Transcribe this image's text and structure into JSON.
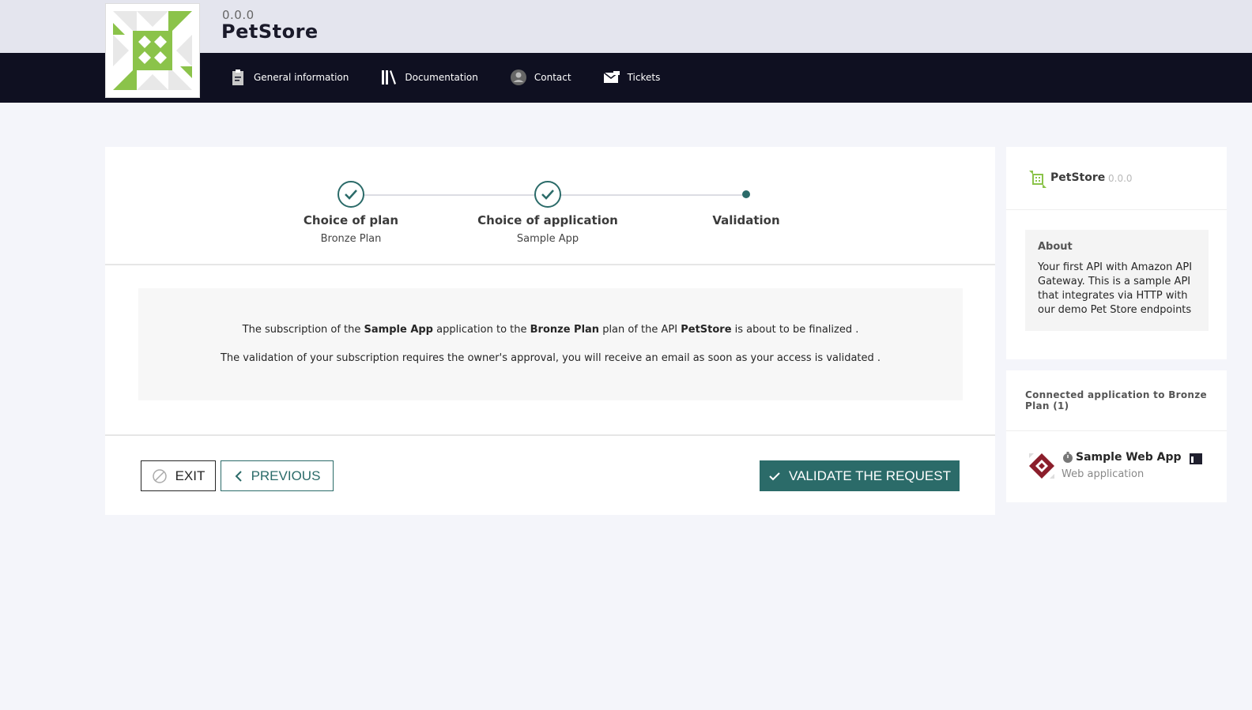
{
  "header": {
    "version": "0.0.0",
    "api_name": "PetStore"
  },
  "nav": {
    "items": [
      {
        "label": "General information",
        "icon": "clipboard-icon"
      },
      {
        "label": "Documentation",
        "icon": "library-icon"
      },
      {
        "label": "Contact",
        "icon": "user-avatar-icon"
      },
      {
        "label": "Tickets",
        "icon": "envelope-icon"
      }
    ]
  },
  "stepper": {
    "steps": [
      {
        "title": "Choice of plan",
        "subtitle": "Bronze Plan",
        "state": "done"
      },
      {
        "title": "Choice of application",
        "subtitle": "Sample App",
        "state": "done"
      },
      {
        "title": "Validation",
        "subtitle": "",
        "state": "current"
      }
    ]
  },
  "message": {
    "line1": {
      "t1": "The subscription of the ",
      "app": "Sample App",
      "t2": " application to the ",
      "plan": "Bronze Plan",
      "t3": " plan of the API ",
      "api": "PetStore",
      "t4": " is about to be finalized ."
    },
    "line2": "The validation of your subscription requires the owner's approval, you will receive an email as soon as your access is validated ."
  },
  "actions": {
    "exit_label": "EXIT",
    "previous_label": "PREVIOUS",
    "validate_label": "VALIDATE THE REQUEST"
  },
  "sidebar": {
    "api_name": "PetStore",
    "api_version": "0.0.0",
    "about_title": "About",
    "about_text": "Your first API with Amazon API Gateway. This is a sample API that integrates via HTTP with our demo Pet Store endpoints",
    "connected_title": "Connected application to Bronze Plan (1)",
    "app": {
      "name": "Sample Web App",
      "type": "Web application"
    }
  },
  "colors": {
    "accent": "#2b6b69",
    "nav_bg": "#0f1021",
    "header_bg": "#e4e5ee",
    "logo_green": "#8bc34a"
  }
}
